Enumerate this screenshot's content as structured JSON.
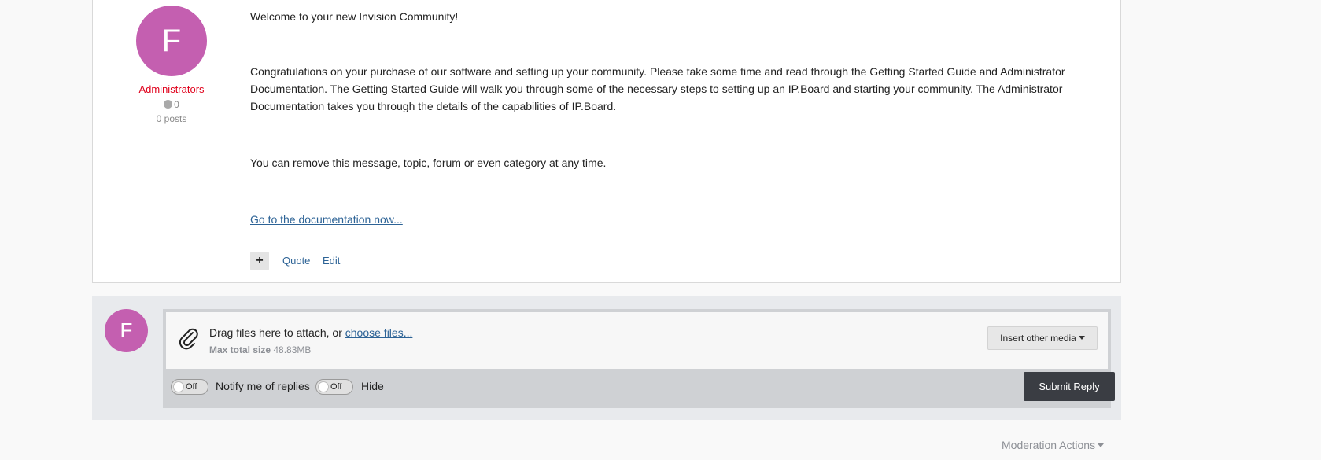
{
  "post": {
    "author_initial": "F",
    "author_group": "Administrators",
    "reputation": "0",
    "post_count": "0 posts",
    "paragraphs": [
      "Welcome to your new Invision Community!",
      "Congratulations on your purchase of our software and setting up your community. Please take some time and read through the Getting Started Guide and Administrator Documentation. The Getting Started Guide will walk you through some of the necessary steps to setting up an IP.Board and starting your community. The Administrator Documentation takes you through the details of the capabilities of IP.Board.",
      "You can remove this message, topic, forum or even category at any time."
    ],
    "doc_link": "Go to the documentation now...",
    "controls": {
      "plus": "+",
      "quote": "Quote",
      "edit": "Edit"
    }
  },
  "reply": {
    "avatar_initial": "F",
    "drag_text": "Drag files here to attach, or ",
    "choose_files": "choose files...",
    "max_size_label": "Max total size",
    "max_size_value": "48.83MB",
    "insert_media": "Insert other media",
    "notify_toggle": "Off",
    "notify_label": "Notify me of replies",
    "hide_toggle": "Off",
    "hide_label": "Hide",
    "submit": "Submit Reply"
  },
  "moderation_actions": "Moderation Actions",
  "icons": {
    "attach": "paperclip-icon",
    "plus": "plus-icon",
    "dropdown": "caret-down-icon"
  },
  "colors": {
    "avatar": "#c45fb0",
    "group": "#e0001b",
    "link": "#2d6396",
    "submit": "#3a3d43"
  }
}
